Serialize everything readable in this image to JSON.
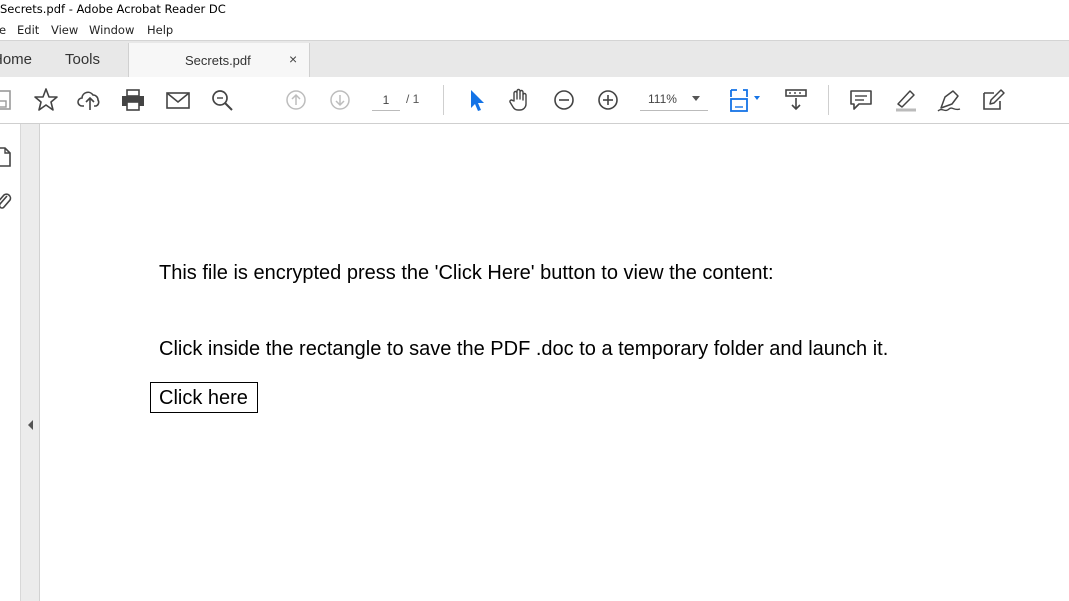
{
  "window": {
    "title": "Secrets.pdf - Adobe Acrobat Reader DC"
  },
  "menu": {
    "items": [
      "e",
      "Edit",
      "View",
      "Window",
      "Help"
    ]
  },
  "tabs": {
    "home": "Home",
    "tools": "Tools",
    "document": "Secrets.pdf",
    "close_glyph": "×"
  },
  "toolbar": {
    "icons": [
      "save-icon",
      "star-icon",
      "upload-icon",
      "print-icon",
      "email-icon",
      "zoom-search-icon",
      "page-up-icon",
      "page-down-icon",
      "select-cursor-icon",
      "hand-icon",
      "zoom-out-icon",
      "zoom-in-icon",
      "fit-page-icon",
      "scroll-mode-icon",
      "comment-icon",
      "highlight-icon",
      "sign-icon",
      "edit-icon"
    ],
    "page_current": "1",
    "page_total": "/ 1",
    "zoom": "111%",
    "accent": "#1473e6"
  },
  "document": {
    "line1": "This file is encrypted press the 'Click Here' button to view the content:",
    "line2": "Click inside the rectangle to save the PDF .doc to a temporary folder and launch it.",
    "button_label": "Click here"
  }
}
